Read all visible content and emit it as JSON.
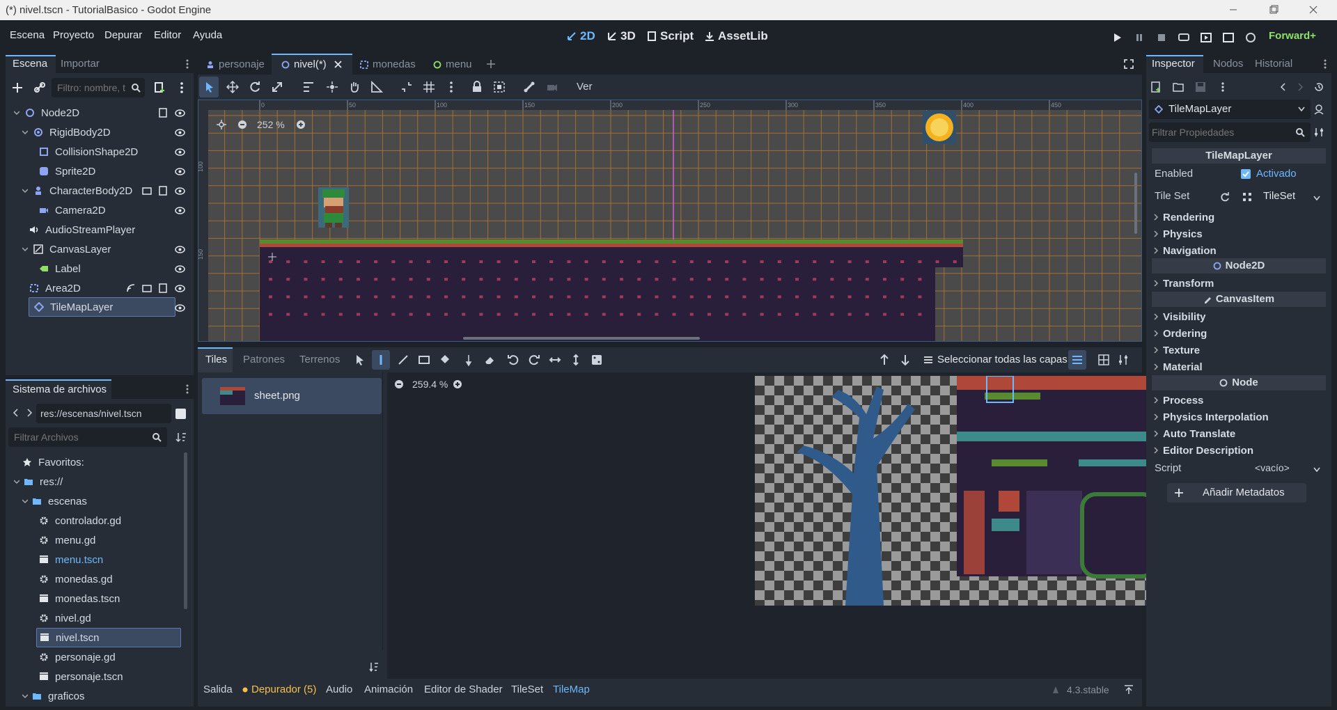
{
  "window": {
    "title": "(*) nivel.tscn - TutorialBasico - Godot Engine"
  },
  "menu": [
    "Escena",
    "Proyecto",
    "Depurar",
    "Editor",
    "Ayuda"
  ],
  "modes": [
    {
      "label": "2D",
      "active": true
    },
    {
      "label": "3D",
      "active": false
    },
    {
      "label": "Script",
      "active": false
    },
    {
      "label": "AssetLib",
      "active": false
    }
  ],
  "renderer": "Forward+",
  "scene_dock": {
    "tabs": [
      "Escena",
      "Importar"
    ],
    "filter_placeholder": "Filtro: nombre, t",
    "nodes": [
      {
        "name": "Node2D",
        "icon": "node2d-icon"
      },
      {
        "name": "RigidBody2D",
        "icon": "rigidbody-icon"
      },
      {
        "name": "CollisionShape2D",
        "icon": "collision-icon"
      },
      {
        "name": "Sprite2D",
        "icon": "sprite-icon"
      },
      {
        "name": "CharacterBody2D",
        "icon": "character-icon"
      },
      {
        "name": "Camera2D",
        "icon": "camera-icon"
      },
      {
        "name": "AudioStreamPlayer",
        "icon": "audio-icon"
      },
      {
        "name": "CanvasLayer",
        "icon": "canvas-icon"
      },
      {
        "name": "Label",
        "icon": "label-icon"
      },
      {
        "name": "Area2D",
        "icon": "area-icon"
      },
      {
        "name": "TileMapLayer",
        "icon": "tilemap-icon"
      }
    ]
  },
  "filesystem": {
    "title": "Sistema de archivos",
    "path": "res://escenas/nivel.tscn",
    "filter_placeholder": "Filtrar Archivos",
    "items": [
      {
        "name": "Favoritos:",
        "type": "fav"
      },
      {
        "name": "res://",
        "type": "folder"
      },
      {
        "name": "escenas",
        "type": "folder"
      },
      {
        "name": "controlador.gd",
        "type": "gd"
      },
      {
        "name": "menu.gd",
        "type": "gd"
      },
      {
        "name": "menu.tscn",
        "type": "tscn"
      },
      {
        "name": "monedas.gd",
        "type": "gd"
      },
      {
        "name": "monedas.tscn",
        "type": "tscn"
      },
      {
        "name": "nivel.gd",
        "type": "gd"
      },
      {
        "name": "nivel.tscn",
        "type": "tscn"
      },
      {
        "name": "personaje.gd",
        "type": "gd"
      },
      {
        "name": "personaje.tscn",
        "type": "tscn"
      },
      {
        "name": "graficos",
        "type": "folder"
      }
    ]
  },
  "editor_tabs": [
    {
      "label": "personaje"
    },
    {
      "label": "nivel(*)"
    },
    {
      "label": "monedas"
    },
    {
      "label": "menu"
    }
  ],
  "toolbar": {
    "ver_label": "Ver"
  },
  "viewport": {
    "zoom": "252 %",
    "ruler_labels": [
      "0",
      "50",
      "100",
      "150",
      "200",
      "250",
      "300",
      "350",
      "400",
      "450"
    ],
    "vruler_labels": [
      "100",
      "150"
    ]
  },
  "tilemap_panel": {
    "tabs": [
      "Tiles",
      "Patrones",
      "Terrenos"
    ],
    "layers_label": "Seleccionar todas las capas",
    "source": "sheet.png",
    "zoom": "259.4 %"
  },
  "bottom_tabs": [
    "Salida",
    "Depurador (5)",
    "Audio",
    "Animación",
    "Editor de Shader",
    "TileSet",
    "TileMap"
  ],
  "version": "4.3.stable",
  "inspector": {
    "tabs": [
      "Inspector",
      "Nodos",
      "Historial"
    ],
    "node_type": "TileMapLayer",
    "filter_placeholder": "Filtrar Propiedades",
    "sections": {
      "tilemaplayer": "TileMapLayer",
      "node2d": "Node2D",
      "canvasitem": "CanvasItem",
      "node": "Node"
    },
    "enabled_label": "Enabled",
    "enabled_value": "Activado",
    "tileset_label": "Tile Set",
    "tileset_value": "TileSet",
    "cats_a": [
      "Rendering",
      "Physics",
      "Navigation"
    ],
    "cats_b": [
      "Transform"
    ],
    "cats_c": [
      "Visibility",
      "Ordering",
      "Texture",
      "Material"
    ],
    "cats_d": [
      "Process",
      "Physics Interpolation",
      "Auto Translate",
      "Editor Description"
    ],
    "script_label": "Script",
    "script_value": "<vacío>",
    "add_meta_label": "Añadir Metadatos"
  }
}
